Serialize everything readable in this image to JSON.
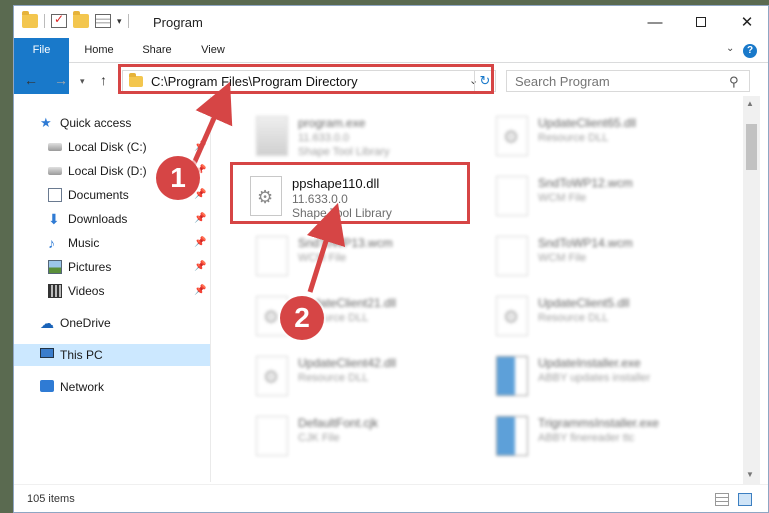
{
  "window": {
    "title": "Program",
    "min_glyph": "—",
    "close_glyph": "✕"
  },
  "ribbon": {
    "file": "File",
    "home": "Home",
    "share": "Share",
    "view": "View",
    "help_glyph": "?"
  },
  "navigation": {
    "back_glyph": "←",
    "forward_glyph": "→",
    "recent_glyph": "▾",
    "up_glyph": "↑",
    "address": "C:\\Program Files\\Program Directory",
    "address_dropdown_glyph": "⌄",
    "refresh_glyph": "↻",
    "search_placeholder": "Search Program",
    "search_glyph": "⚲"
  },
  "sidebar": {
    "items": [
      {
        "label": "Quick access",
        "icon": "star-icon"
      },
      {
        "label": "Local Disk (C:)",
        "icon": "disk-icon",
        "pinned": true
      },
      {
        "label": "Local Disk (D:)",
        "icon": "disk-icon",
        "pinned": true
      },
      {
        "label": "Documents",
        "icon": "document-icon",
        "pinned": true
      },
      {
        "label": "Downloads",
        "icon": "download-icon",
        "pinned": true
      },
      {
        "label": "Music",
        "icon": "music-icon",
        "pinned": true
      },
      {
        "label": "Pictures",
        "icon": "pictures-icon",
        "pinned": true
      },
      {
        "label": "Videos",
        "icon": "videos-icon",
        "pinned": true
      },
      {
        "label": "OneDrive",
        "icon": "cloud-icon"
      },
      {
        "label": "This PC",
        "icon": "computer-icon",
        "selected": true
      },
      {
        "label": "Network",
        "icon": "network-icon"
      }
    ],
    "pin_glyph": "📌"
  },
  "files": [
    {
      "name": "program.exe",
      "sub1": "11.633.0.0",
      "sub2": "Shape Tool Library",
      "kind": "exe"
    },
    {
      "name": "UpdateClient65.dll",
      "sub1": "Resource DLL",
      "sub2": "",
      "kind": "dll"
    },
    {
      "name": "ppshape110.dll",
      "sub1": "11.633.0.0",
      "sub2": "Shape Tool Library",
      "kind": "dll"
    },
    {
      "name": "SndToWP12.wcm",
      "sub1": "WCM File",
      "sub2": "",
      "kind": "blank"
    },
    {
      "name": "SndToWP13.wcm",
      "sub1": "WCM File",
      "sub2": "",
      "kind": "blank"
    },
    {
      "name": "SndToWP14.wcm",
      "sub1": "WCM File",
      "sub2": "",
      "kind": "blank"
    },
    {
      "name": "UpdateClient21.dll",
      "sub1": "Resource DLL",
      "sub2": "",
      "kind": "dll"
    },
    {
      "name": "UpdateClient5.dll",
      "sub1": "Resource DLL",
      "sub2": "",
      "kind": "dll"
    },
    {
      "name": "UpdateClient42.dll",
      "sub1": "Resource DLL",
      "sub2": "",
      "kind": "dll"
    },
    {
      "name": "UpdateInstaller.exe",
      "sub1": "ABBY updates installer",
      "sub2": "",
      "kind": "installer"
    },
    {
      "name": "DefaultFont.cjk",
      "sub1": "CJK File",
      "sub2": "",
      "kind": "blank"
    },
    {
      "name": "TrigrammsInstaller.exe",
      "sub1": "ABBY finereader ttc",
      "sub2": "",
      "kind": "installer"
    }
  ],
  "scrollbar": {
    "up_glyph": "▲",
    "down_glyph": "▼"
  },
  "status": {
    "item_count": "105 items"
  },
  "annotations": {
    "step1": "1",
    "step2": "2",
    "color": "#d64545"
  }
}
